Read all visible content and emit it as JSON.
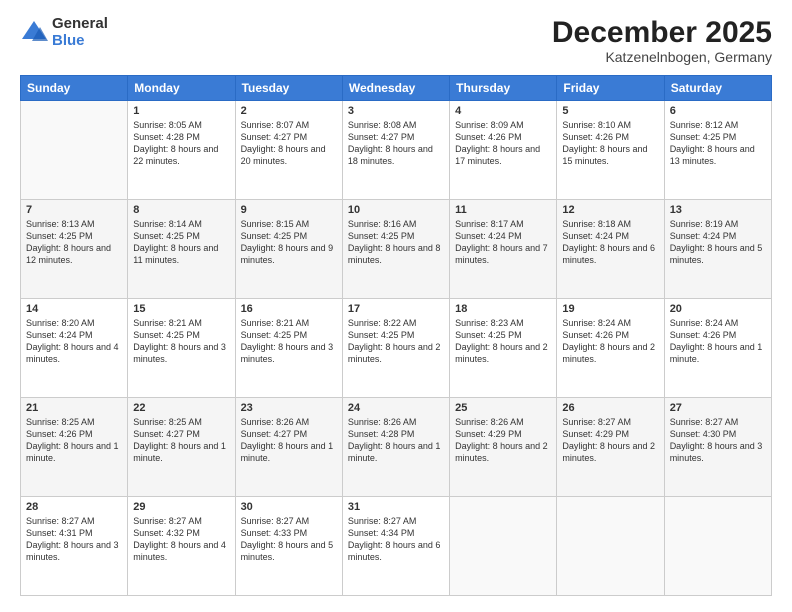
{
  "logo": {
    "general": "General",
    "blue": "Blue"
  },
  "header": {
    "month": "December 2025",
    "location": "Katzenelnbogen, Germany"
  },
  "weekdays": [
    "Sunday",
    "Monday",
    "Tuesday",
    "Wednesday",
    "Thursday",
    "Friday",
    "Saturday"
  ],
  "weeks": [
    [
      {
        "day": "",
        "sunrise": "",
        "sunset": "",
        "daylight": ""
      },
      {
        "day": "1",
        "sunrise": "Sunrise: 8:05 AM",
        "sunset": "Sunset: 4:28 PM",
        "daylight": "Daylight: 8 hours and 22 minutes."
      },
      {
        "day": "2",
        "sunrise": "Sunrise: 8:07 AM",
        "sunset": "Sunset: 4:27 PM",
        "daylight": "Daylight: 8 hours and 20 minutes."
      },
      {
        "day": "3",
        "sunrise": "Sunrise: 8:08 AM",
        "sunset": "Sunset: 4:27 PM",
        "daylight": "Daylight: 8 hours and 18 minutes."
      },
      {
        "day": "4",
        "sunrise": "Sunrise: 8:09 AM",
        "sunset": "Sunset: 4:26 PM",
        "daylight": "Daylight: 8 hours and 17 minutes."
      },
      {
        "day": "5",
        "sunrise": "Sunrise: 8:10 AM",
        "sunset": "Sunset: 4:26 PM",
        "daylight": "Daylight: 8 hours and 15 minutes."
      },
      {
        "day": "6",
        "sunrise": "Sunrise: 8:12 AM",
        "sunset": "Sunset: 4:25 PM",
        "daylight": "Daylight: 8 hours and 13 minutes."
      }
    ],
    [
      {
        "day": "7",
        "sunrise": "Sunrise: 8:13 AM",
        "sunset": "Sunset: 4:25 PM",
        "daylight": "Daylight: 8 hours and 12 minutes."
      },
      {
        "day": "8",
        "sunrise": "Sunrise: 8:14 AM",
        "sunset": "Sunset: 4:25 PM",
        "daylight": "Daylight: 8 hours and 11 minutes."
      },
      {
        "day": "9",
        "sunrise": "Sunrise: 8:15 AM",
        "sunset": "Sunset: 4:25 PM",
        "daylight": "Daylight: 8 hours and 9 minutes."
      },
      {
        "day": "10",
        "sunrise": "Sunrise: 8:16 AM",
        "sunset": "Sunset: 4:25 PM",
        "daylight": "Daylight: 8 hours and 8 minutes."
      },
      {
        "day": "11",
        "sunrise": "Sunrise: 8:17 AM",
        "sunset": "Sunset: 4:24 PM",
        "daylight": "Daylight: 8 hours and 7 minutes."
      },
      {
        "day": "12",
        "sunrise": "Sunrise: 8:18 AM",
        "sunset": "Sunset: 4:24 PM",
        "daylight": "Daylight: 8 hours and 6 minutes."
      },
      {
        "day": "13",
        "sunrise": "Sunrise: 8:19 AM",
        "sunset": "Sunset: 4:24 PM",
        "daylight": "Daylight: 8 hours and 5 minutes."
      }
    ],
    [
      {
        "day": "14",
        "sunrise": "Sunrise: 8:20 AM",
        "sunset": "Sunset: 4:24 PM",
        "daylight": "Daylight: 8 hours and 4 minutes."
      },
      {
        "day": "15",
        "sunrise": "Sunrise: 8:21 AM",
        "sunset": "Sunset: 4:25 PM",
        "daylight": "Daylight: 8 hours and 3 minutes."
      },
      {
        "day": "16",
        "sunrise": "Sunrise: 8:21 AM",
        "sunset": "Sunset: 4:25 PM",
        "daylight": "Daylight: 8 hours and 3 minutes."
      },
      {
        "day": "17",
        "sunrise": "Sunrise: 8:22 AM",
        "sunset": "Sunset: 4:25 PM",
        "daylight": "Daylight: 8 hours and 2 minutes."
      },
      {
        "day": "18",
        "sunrise": "Sunrise: 8:23 AM",
        "sunset": "Sunset: 4:25 PM",
        "daylight": "Daylight: 8 hours and 2 minutes."
      },
      {
        "day": "19",
        "sunrise": "Sunrise: 8:24 AM",
        "sunset": "Sunset: 4:26 PM",
        "daylight": "Daylight: 8 hours and 2 minutes."
      },
      {
        "day": "20",
        "sunrise": "Sunrise: 8:24 AM",
        "sunset": "Sunset: 4:26 PM",
        "daylight": "Daylight: 8 hours and 1 minute."
      }
    ],
    [
      {
        "day": "21",
        "sunrise": "Sunrise: 8:25 AM",
        "sunset": "Sunset: 4:26 PM",
        "daylight": "Daylight: 8 hours and 1 minute."
      },
      {
        "day": "22",
        "sunrise": "Sunrise: 8:25 AM",
        "sunset": "Sunset: 4:27 PM",
        "daylight": "Daylight: 8 hours and 1 minute."
      },
      {
        "day": "23",
        "sunrise": "Sunrise: 8:26 AM",
        "sunset": "Sunset: 4:27 PM",
        "daylight": "Daylight: 8 hours and 1 minute."
      },
      {
        "day": "24",
        "sunrise": "Sunrise: 8:26 AM",
        "sunset": "Sunset: 4:28 PM",
        "daylight": "Daylight: 8 hours and 1 minute."
      },
      {
        "day": "25",
        "sunrise": "Sunrise: 8:26 AM",
        "sunset": "Sunset: 4:29 PM",
        "daylight": "Daylight: 8 hours and 2 minutes."
      },
      {
        "day": "26",
        "sunrise": "Sunrise: 8:27 AM",
        "sunset": "Sunset: 4:29 PM",
        "daylight": "Daylight: 8 hours and 2 minutes."
      },
      {
        "day": "27",
        "sunrise": "Sunrise: 8:27 AM",
        "sunset": "Sunset: 4:30 PM",
        "daylight": "Daylight: 8 hours and 3 minutes."
      }
    ],
    [
      {
        "day": "28",
        "sunrise": "Sunrise: 8:27 AM",
        "sunset": "Sunset: 4:31 PM",
        "daylight": "Daylight: 8 hours and 3 minutes."
      },
      {
        "day": "29",
        "sunrise": "Sunrise: 8:27 AM",
        "sunset": "Sunset: 4:32 PM",
        "daylight": "Daylight: 8 hours and 4 minutes."
      },
      {
        "day": "30",
        "sunrise": "Sunrise: 8:27 AM",
        "sunset": "Sunset: 4:33 PM",
        "daylight": "Daylight: 8 hours and 5 minutes."
      },
      {
        "day": "31",
        "sunrise": "Sunrise: 8:27 AM",
        "sunset": "Sunset: 4:34 PM",
        "daylight": "Daylight: 8 hours and 6 minutes."
      },
      {
        "day": "",
        "sunrise": "",
        "sunset": "",
        "daylight": ""
      },
      {
        "day": "",
        "sunrise": "",
        "sunset": "",
        "daylight": ""
      },
      {
        "day": "",
        "sunrise": "",
        "sunset": "",
        "daylight": ""
      }
    ]
  ]
}
